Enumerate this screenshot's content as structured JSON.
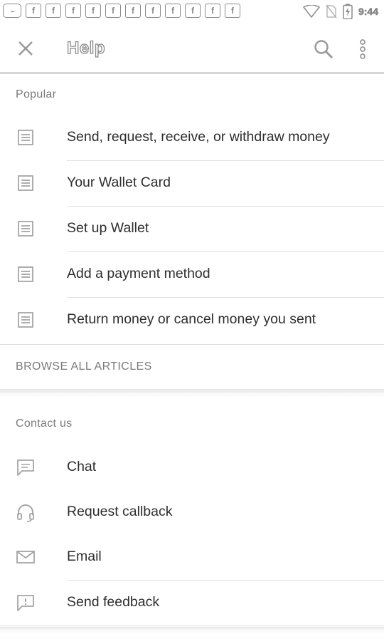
{
  "status_bar": {
    "notification_icons": [
      "f",
      "f",
      "f",
      "f",
      "f",
      "f",
      "f",
      "f",
      "f",
      "f",
      "f"
    ],
    "message_icon": "...",
    "time": "9:44"
  },
  "toolbar": {
    "title": "Help",
    "close_icon": "close-icon",
    "search_icon": "search-icon",
    "more_icon": "more-vert-icon"
  },
  "popular": {
    "header": "Popular",
    "items": [
      {
        "label": "Send, request, receive, or withdraw money",
        "icon": "article-icon"
      },
      {
        "label": "Your Wallet Card",
        "icon": "article-icon"
      },
      {
        "label": "Set up Wallet",
        "icon": "article-icon"
      },
      {
        "label": "Add a payment method",
        "icon": "article-icon"
      },
      {
        "label": "Return money or cancel money you sent",
        "icon": "article-icon"
      }
    ]
  },
  "browse": {
    "label": "BROWSE ALL ARTICLES"
  },
  "contact": {
    "header": "Contact us",
    "items": [
      {
        "label": "Chat",
        "icon": "chat-icon"
      },
      {
        "label": "Request callback",
        "icon": "headset-icon"
      },
      {
        "label": "Email",
        "icon": "email-icon"
      },
      {
        "label": "Send feedback",
        "icon": "feedback-icon"
      }
    ]
  },
  "colors": {
    "icon_gray": "#9a9a9a",
    "text_primary": "#2e2e2e",
    "text_secondary": "#7a7a7a",
    "divider": "#e2e2e2"
  }
}
